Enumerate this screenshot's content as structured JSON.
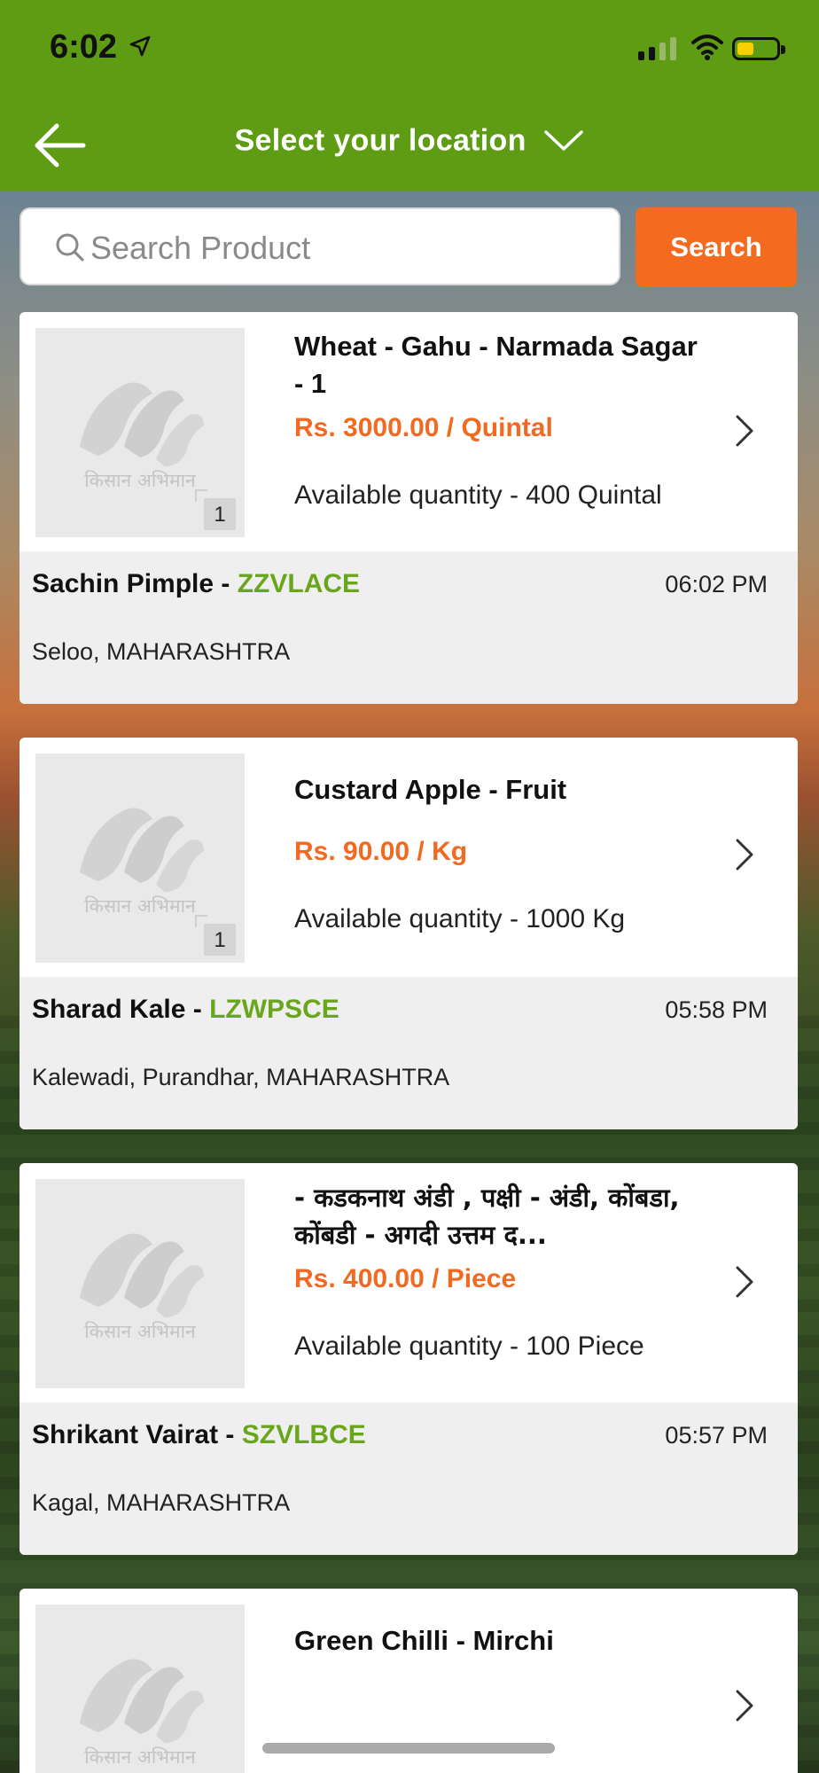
{
  "status_bar": {
    "time": "6:02",
    "location_icon": "location-arrow-icon",
    "signal_icon": "cellular-signal-icon",
    "wifi_icon": "wifi-icon",
    "battery_icon": "battery-icon"
  },
  "header": {
    "back_icon": "back-arrow-icon",
    "location_label": "Select your location",
    "dropdown_icon": "chevron-down-icon",
    "bg_color": "#5e9c14"
  },
  "search": {
    "placeholder": "Search Product",
    "value": "",
    "button_label": "Search",
    "button_color": "#f46a1f"
  },
  "logo_text": "किसान अभिमान",
  "products": [
    {
      "name": "Wheat - Gahu - Narmada Sagar - 1",
      "price": "Rs. 3000.00 / Quintal",
      "quantity": "Available quantity - 400 Quintal",
      "image_count": "1",
      "seller_name": "Sachin Pimple - ",
      "seller_code": "ZZVLACE",
      "time": "06:02 PM",
      "location": "Seloo, MAHARASHTRA"
    },
    {
      "name": "Custard Apple - Fruit",
      "price": "Rs. 90.00 / Kg",
      "quantity": "Available quantity - 1000 Kg",
      "image_count": "1",
      "seller_name": "Sharad Kale - ",
      "seller_code": "LZWPSCE",
      "time": "05:58 PM",
      "location": "Kalewadi, Purandhar, MAHARASHTRA"
    },
    {
      "name": "- कडकनाथ अंडी , पक्षी - अंडी, कोंबडा, कोंबडी - अगदी उत्तम द...",
      "price": "Rs. 400.00 / Piece",
      "quantity": "Available quantity - 100 Piece",
      "image_count": "",
      "seller_name": "Shrikant Vairat - ",
      "seller_code": "SZVLBCE",
      "time": "05:57 PM",
      "location": "Kagal, MAHARASHTRA"
    },
    {
      "name": "Green Chilli - Mirchi"
    }
  ],
  "colors": {
    "price": "#f26a22",
    "seller_code": "#6aa61c"
  }
}
